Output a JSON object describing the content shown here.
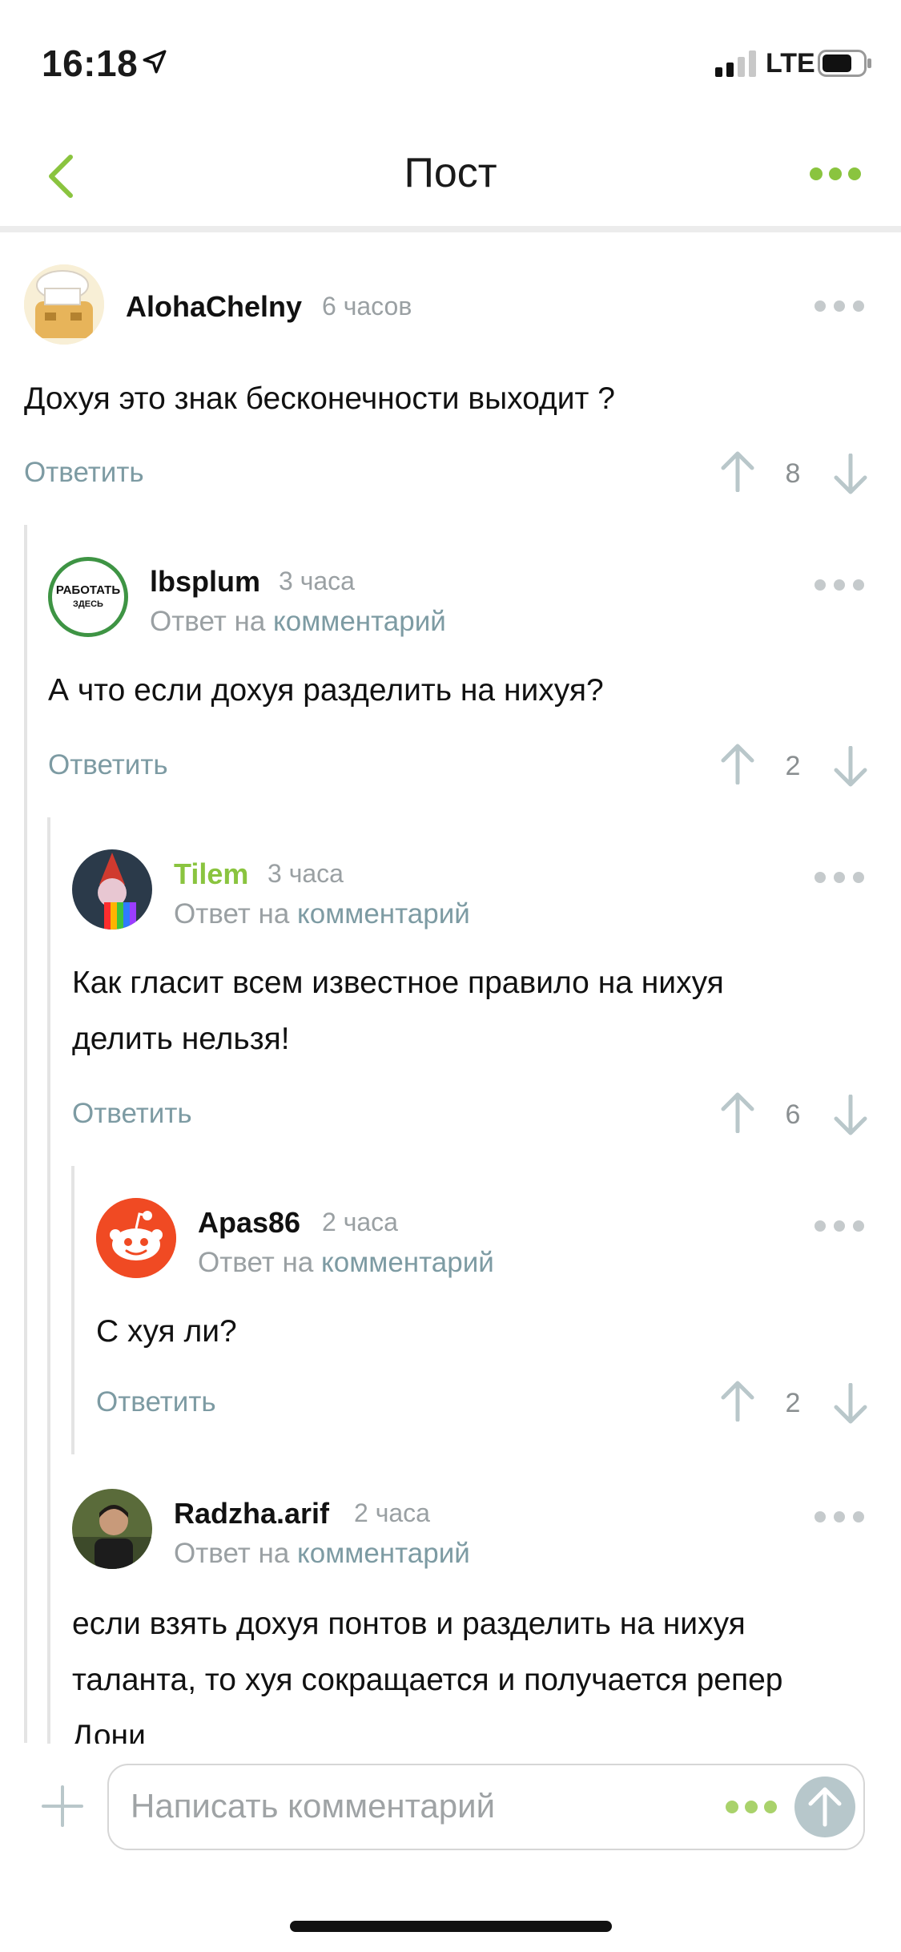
{
  "status_bar": {
    "time": "16:18",
    "network": "LTE"
  },
  "nav": {
    "title": "Пост"
  },
  "colors": {
    "accent_green": "#8ac43f",
    "link_gray": "#7d9ba3",
    "muted_gray": "#9aa0a3"
  },
  "comments": [
    {
      "username": "AlohaChelny",
      "time": "6 часов",
      "text": "Дохуя это знак бесконечности выходит ?",
      "reply_label": "Ответить",
      "score": "8"
    },
    {
      "username": "lbsplum",
      "time": "3 часа",
      "reply_prefix": "Ответ на",
      "reply_link": "комментарий",
      "text": "А что если дохуя разделить на нихуя?",
      "reply_label": "Ответить",
      "score": "2",
      "avatar_text_1": "РАБОТАТЬ",
      "avatar_text_2": "ЗДЕСЬ"
    },
    {
      "username": "Tilem",
      "time": "3 часа",
      "reply_prefix": "Ответ на",
      "reply_link": "комментарий",
      "text_line1": "Как гласит всем известное правило на нихуя",
      "text_line2": "делить нельзя!",
      "reply_label": "Ответить",
      "score": "6"
    },
    {
      "username": "Apas86",
      "time": "2 часа",
      "reply_prefix": "Ответ на",
      "reply_link": "комментарий",
      "text": "С хуя ли?",
      "reply_label": "Ответить",
      "score": "2"
    },
    {
      "username": "Radzha.arif",
      "time": "2 часа",
      "reply_prefix": "Ответ на",
      "reply_link": "комментарий",
      "text_line1": "если взять дохуя понтов и разделить на нихуя",
      "text_line2": "таланта, то хуя сокращается и получается репер",
      "text_line3": "Дони"
    }
  ],
  "composer": {
    "placeholder": "Написать комментарий"
  },
  "icons": [
    "location-arrow-icon",
    "signal-icon",
    "battery-icon",
    "back-chevron-icon",
    "more-dots-icon",
    "upvote-arrow-icon",
    "downvote-arrow-icon",
    "plus-icon",
    "send-arrow-icon"
  ]
}
